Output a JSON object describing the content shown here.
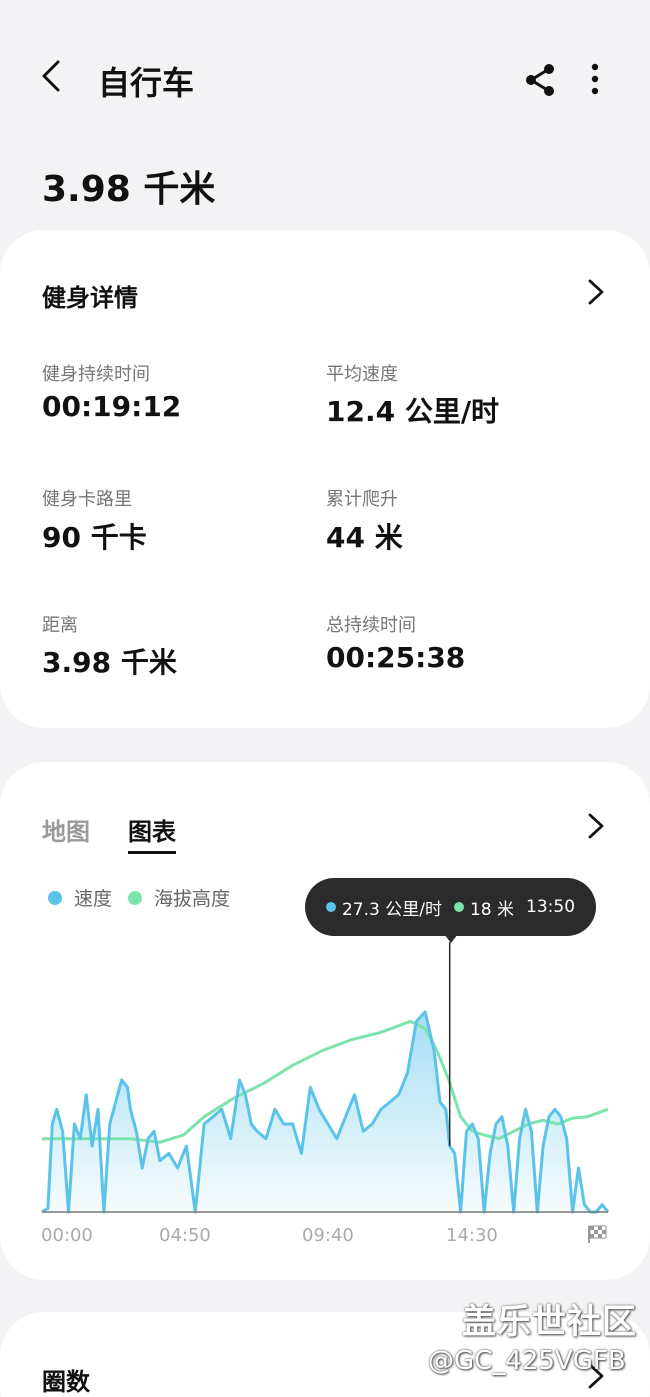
{
  "header": {
    "title": "自行车",
    "distance": "3.98 千米"
  },
  "details": {
    "title": "健身详情",
    "stats": [
      {
        "label": "健身持续时间",
        "value": "00:19:12"
      },
      {
        "label": "平均速度",
        "value": "12.4 公里/时"
      },
      {
        "label": "健身卡路里",
        "value": "90 千卡"
      },
      {
        "label": "累计爬升",
        "value": "44 米"
      },
      {
        "label": "距离",
        "value": "3.98 千米"
      },
      {
        "label": "总持续时间",
        "value": "00:25:38"
      }
    ]
  },
  "chart_card": {
    "tabs": [
      "地图",
      "图表"
    ],
    "active_tab": "图表",
    "tooltip": {
      "speed": "27.3 公里/时",
      "altitude": "18 米",
      "time": "13:50"
    }
  },
  "laps": {
    "title": "圈数"
  },
  "watermark": {
    "line1": "盖乐世社区",
    "line2": "@GC_425VGFB"
  },
  "colors": {
    "speed": "#5bc3ea",
    "altitude": "#7de3ac",
    "tooltip_bg": "#2b2b2b"
  },
  "chart_data": {
    "type": "area",
    "xlabel": "",
    "ylabel": "",
    "x_ticks": [
      "00:00",
      "04:50",
      "09:40",
      "14:30"
    ],
    "x_range": [
      0,
      19.2
    ],
    "series": [
      {
        "name": "速度",
        "x": [
          0.0,
          0.2,
          0.35,
          0.5,
          0.7,
          0.9,
          1.1,
          1.3,
          1.5,
          1.7,
          1.9,
          2.1,
          2.3,
          2.5,
          2.7,
          2.9,
          3.0,
          3.2,
          3.4,
          3.6,
          3.8,
          4.0,
          4.3,
          4.6,
          4.9,
          5.2,
          5.5,
          5.8,
          6.1,
          6.4,
          6.7,
          6.9,
          7.1,
          7.3,
          7.6,
          7.9,
          8.2,
          8.5,
          8.8,
          9.1,
          9.4,
          9.7,
          10.0,
          10.3,
          10.6,
          10.9,
          11.2,
          11.5,
          11.8,
          12.1,
          12.4,
          12.7,
          13.0,
          13.3,
          13.5,
          13.7,
          13.83,
          14.0,
          14.2,
          14.4,
          14.6,
          14.8,
          15.0,
          15.2,
          15.4,
          15.6,
          15.8,
          16.0,
          16.2,
          16.4,
          16.6,
          16.8,
          17.0,
          17.2,
          17.4,
          17.6,
          17.8,
          18.0,
          18.2,
          18.4,
          18.6,
          18.8,
          19.0,
          19.2
        ],
        "values": [
          0,
          0.5,
          12,
          14,
          11,
          0,
          12,
          10,
          16,
          9,
          14,
          0,
          12,
          15,
          18,
          17,
          14,
          11,
          6,
          10,
          11,
          7,
          8,
          6,
          9,
          0,
          12,
          13,
          14,
          10,
          18,
          16,
          12,
          11,
          10,
          14,
          12,
          12,
          8,
          17,
          14,
          12,
          10,
          13,
          16,
          11,
          12,
          14,
          15,
          16,
          19,
          26,
          27.3,
          22,
          15,
          14,
          9,
          8,
          0,
          11,
          12,
          10,
          0,
          8,
          12,
          13,
          9,
          0,
          10,
          14,
          11,
          0,
          9,
          13,
          14,
          13,
          10,
          0,
          6,
          1,
          0,
          0,
          1,
          0
        ]
      },
      {
        "name": "海拔高度",
        "x": [
          0,
          1,
          2,
          3,
          4,
          4.8,
          5.5,
          6.5,
          7.5,
          8.5,
          9.5,
          10.5,
          11.5,
          12.5,
          13.0,
          13.4,
          13.8,
          14.2,
          14.6,
          15.0,
          15.5,
          16.0,
          16.5,
          17.0,
          17.5,
          18.0,
          18.5,
          19.2
        ],
        "values": [
          10,
          10,
          10,
          10,
          9.5,
          10.5,
          13,
          15.5,
          17.5,
          20,
          22,
          23.5,
          24.5,
          26,
          25,
          22,
          18,
          13,
          11,
          10.5,
          10,
          11,
          12,
          12.5,
          12,
          12.8,
          13,
          14
        ]
      }
    ],
    "ylim": [
      0,
      30
    ],
    "legend": "top-left",
    "grid": false
  }
}
